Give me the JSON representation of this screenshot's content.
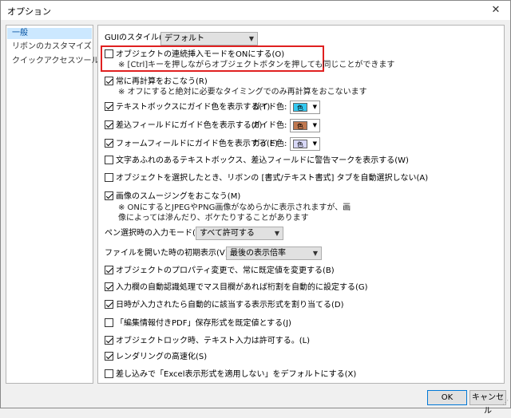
{
  "window": {
    "title": "オプション",
    "close_glyph": "✕"
  },
  "sidebar": {
    "items": [
      {
        "label": "一般",
        "selected": true
      },
      {
        "label": "リボンのカスタマイズ",
        "selected": false
      },
      {
        "label": "クイックアクセスツールバー",
        "selected": false
      }
    ]
  },
  "options": {
    "gui_style": {
      "label": "GUIのスタイル(P):",
      "value": "デフォルト"
    },
    "continuous_insert": {
      "label": "オブジェクトの連続挿入モードをONにする(O)",
      "checked": false,
      "note": "※ [Ctrl]キーを押しながらオブジェクトボタンを押しても同じことができます"
    },
    "always_recalc": {
      "label": "常に再計算をおこなう(R)",
      "checked": true,
      "note": "※ オフにすると絶対に必要なタイミングでのみ再計算をおこないます"
    },
    "textbox_guide": {
      "label": "テキストボックスにガイド色を表示する(T)",
      "checked": true,
      "guide_label": "ガイド色:",
      "chip": "色",
      "color": "#33c8f0"
    },
    "mailmerge_guide": {
      "label": "差込フィールドにガイド色を表示する(F)",
      "checked": true,
      "guide_label": "ガイド色:",
      "chip": "色",
      "color": "#c07850"
    },
    "formfield_guide": {
      "label": "フォームフィールドにガイド色を表示する(E)",
      "checked": true,
      "guide_label": "ガイド色:",
      "chip": "色",
      "color": "#d8d8f8"
    },
    "overflow_warning": {
      "label": "文字あふれのあるテキストボックス、差込フィールドに警告マークを表示する(W)",
      "checked": false
    },
    "auto_select_tab": {
      "label": "オブジェクトを選択したとき、リボンの [書式/テキスト書式] タブを自動選択しない(A)",
      "checked": false
    },
    "smoothing": {
      "label": "画像のスムージングをおこなう(M)",
      "checked": true,
      "note": "※ ONにするとJPEGやPNG画像がなめらかに表示されますが、画像によっては滲んだり、ボケたりすることがあります"
    },
    "pen_mode": {
      "label": "ペン選択時の入力モード(C):",
      "value": "すべて許可する"
    },
    "open_zoom": {
      "label": "ファイルを開いた時の初期表示(V):",
      "value": "最後の表示倍率"
    },
    "property_default": {
      "label": "オブジェクトのプロパティ変更で、常に既定値を変更する(B)",
      "checked": true
    },
    "grid_autosplit": {
      "label": "入力欄の自動認識処理でマス目欄があれば桁割を自動的に設定する(G)",
      "checked": true
    },
    "date_format": {
      "label": "日時が入力されたら自動的に該当する表示形式を割り当てる(D)",
      "checked": true
    },
    "pdf_default": {
      "label": "「編集情報付きPDF」保存形式を既定値とする(J)",
      "checked": false
    },
    "lock_text": {
      "label": "オブジェクトロック時、テキスト入力は許可する。(L)",
      "checked": true
    },
    "fast_render": {
      "label": "レンダリングの高速化(S)",
      "checked": true
    },
    "excel_format": {
      "label": "差し込みで「Excel表示形式を適用しない」をデフォルトにする(X)",
      "checked": false
    }
  },
  "footer": {
    "ok": "OK",
    "cancel": "キャンセル"
  },
  "colors": {
    "highlight": "#e02020",
    "selected_bg": "#cce8ff"
  }
}
